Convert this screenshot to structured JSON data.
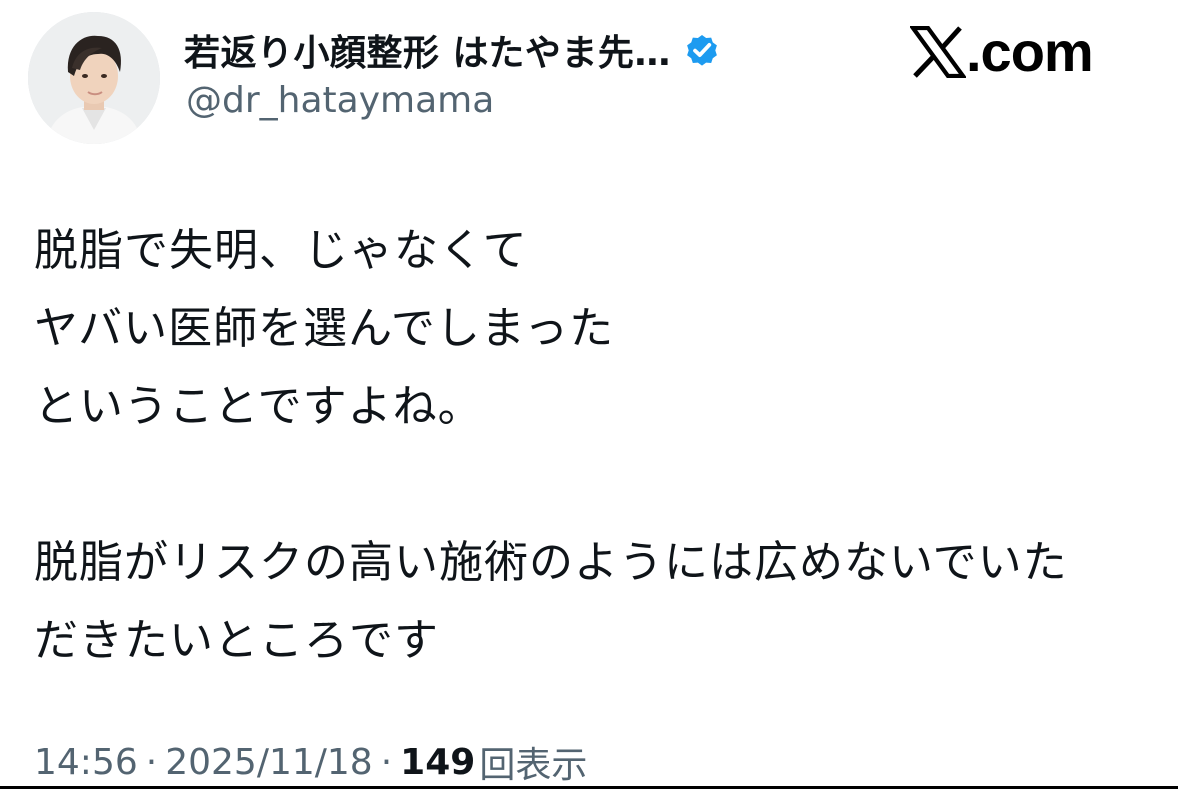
{
  "author": {
    "display_name": "若返り小顔整形 はたやま先…",
    "handle": "@dr_hataymama",
    "verified": true,
    "verified_color": "#1d9bf0",
    "avatar_icon": "profile-photo"
  },
  "branding": {
    "logo_icon": "x-logo-icon",
    "domain_text": ".com"
  },
  "tweet": {
    "lines": [
      "脱脂で失明、じゃなくて",
      "ヤバい医師を選んでしまった",
      "ということですよね。",
      "",
      "脱脂がリスクの高い施術のようには広めないでいた",
      "だきたいところです"
    ]
  },
  "meta": {
    "time": "14:56",
    "date": "2025/11/18",
    "separator": "·",
    "views_count": "149",
    "views_label": "回表示"
  },
  "colors": {
    "text_primary": "#0f1419",
    "text_secondary": "#536471",
    "background": "#ffffff"
  }
}
